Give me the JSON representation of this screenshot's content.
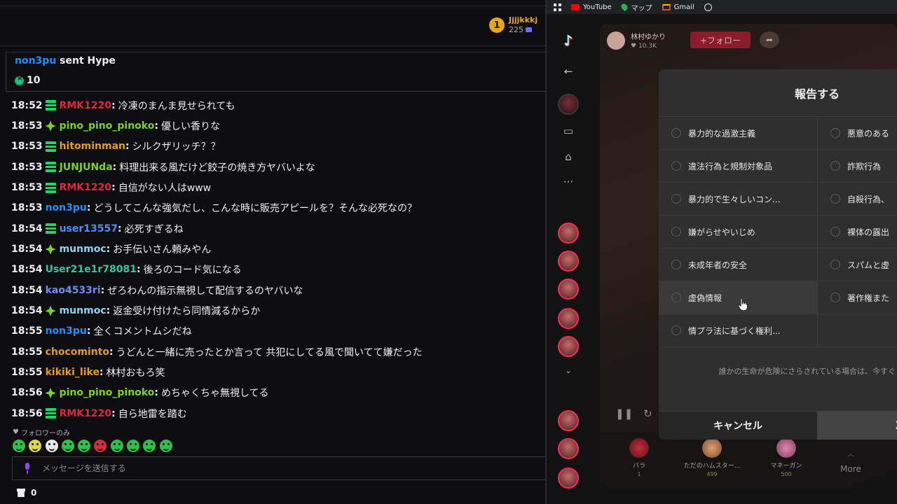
{
  "chat": {
    "leaderboard": {
      "rank": "1",
      "name": "Jjjjkkkj",
      "points": "225"
    },
    "hype": {
      "user": "non3pu",
      "action": "sent Hype",
      "amount": "10"
    },
    "messages": [
      {
        "time": "18:52",
        "badge": "sub",
        "user": "RMK1220",
        "color": "#e0263e",
        "text": "冷凍のまんま見せられても"
      },
      {
        "time": "18:53",
        "badge": "gem",
        "user": "pino_pino_pinoko",
        "color": "#7cd420",
        "text": "優しい香りな"
      },
      {
        "time": "18:53",
        "badge": "sub",
        "user": "hitominman",
        "color": "#e39b2a",
        "text": "シルクザリッチ？？"
      },
      {
        "time": "18:53",
        "badge": "sub",
        "user": "JUNJUNda",
        "color": "#7cd420",
        "text": "料理出来る風だけど餃子の焼き方ヤバいよな"
      },
      {
        "time": "18:53",
        "badge": "sub",
        "user": "RMK1220",
        "color": "#e0263e",
        "text": "自信がない人はwww"
      },
      {
        "time": "18:53",
        "badge": "",
        "user": "non3pu",
        "color": "#1e90ff",
        "text": "どうしてこんな強気だし、こんな時に販売アピールを？そんな必死なの？"
      },
      {
        "time": "18:54",
        "badge": "sub",
        "user": "user13557",
        "color": "#4f8ff0",
        "text": "必死すぎるね"
      },
      {
        "time": "18:54",
        "badge": "gem",
        "user": "munmoc",
        "color": "#8fd3f0",
        "text": "お手伝いさん頼みやん"
      },
      {
        "time": "18:54",
        "badge": "",
        "user": "User21e1r78081",
        "color": "#2fc9a0",
        "text": "後ろのコード気になる"
      },
      {
        "time": "18:54",
        "badge": "",
        "user": "kao4533ri",
        "color": "#6e8ef0",
        "text": "ぜろわんの指示無視して配信するのヤバいな"
      },
      {
        "time": "18:54",
        "badge": "gem",
        "user": "munmoc",
        "color": "#8fd3f0",
        "text": "返金受け付けたら同情減るからか"
      },
      {
        "time": "18:55",
        "badge": "",
        "user": "non3pu",
        "color": "#1e90ff",
        "text": "全くコメントムシだね"
      },
      {
        "time": "18:55",
        "badge": "",
        "user": "chocominto",
        "color": "#e39b2a",
        "text": "うどんと一緒に売ったとか言って 共犯にしてる風で聞いてて嫌だった"
      },
      {
        "time": "18:55",
        "badge": "",
        "user": "kikiki_like",
        "color": "#e39b2a",
        "text": "林村おもろ笑"
      },
      {
        "time": "18:56",
        "badge": "gem",
        "user": "pino_pino_pinoko",
        "color": "#7cd420",
        "text": "めちゃくちゃ無視してる"
      },
      {
        "time": "18:56",
        "badge": "sub",
        "user": "RMK1220",
        "color": "#e0263e",
        "text": "自ら地雷を踏む"
      }
    ],
    "follower_only": "フォロワーのみ",
    "input_placeholder": "メッセージを送信する",
    "points_count": "0"
  },
  "browser": {
    "bookmarks": {
      "youtube": "YouTube",
      "maps": "マップ",
      "gmail": "Gmail"
    },
    "stream": {
      "host_name": "林村ゆかり",
      "host_likes": "10.3K",
      "follow_label": "+フォロー",
      "gifts": [
        {
          "name": "バラ",
          "price": "1"
        },
        {
          "name": "ただのハムスター...",
          "price": "499"
        },
        {
          "name": "マネーガン",
          "price": "500"
        }
      ],
      "more_label": "More"
    },
    "report": {
      "title": "報告する",
      "left_options": [
        "暴力的な過激主義",
        "違法行為と規制対象品",
        "暴力的で生々しいコン...",
        "嫌がらせやいじめ",
        "未成年者の安全",
        "虚偽情報",
        "情プラ法に基づく権利..."
      ],
      "right_options": [
        "悪意のある",
        "詐欺行為",
        "自殺行為、",
        "裸体の露出",
        "スパムと虚",
        "著作権また"
      ],
      "notice": "誰かの生命が危険にさらされている場合は、今すぐ 連絡ください。",
      "cancel_label": "キャンセル",
      "next_label": "次"
    }
  },
  "colors": {
    "background": "#0e0e10",
    "accent": "#9147ff",
    "tiktok_red": "#fe2c55",
    "modal": "#2f2f2f"
  }
}
